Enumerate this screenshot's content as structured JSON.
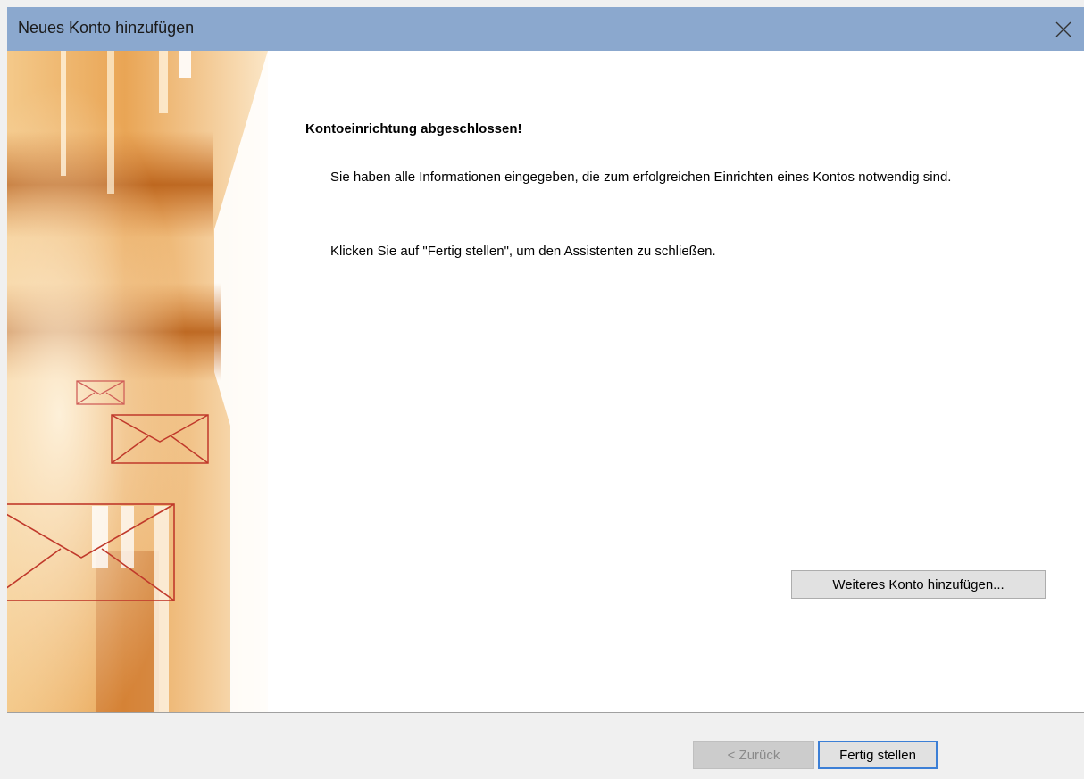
{
  "window": {
    "title": "Neues Konto hinzufügen",
    "close_icon": "close-icon"
  },
  "content": {
    "heading": "Kontoeinrichtung abgeschlossen!",
    "paragraph1": "Sie haben alle Informationen eingegeben, die zum erfolgreichen Einrichten eines Kontos notwendig sind.",
    "paragraph2": "Klicken Sie auf \"Fertig stellen\", um den Assistenten zu schließen.",
    "add_account_button": "Weiteres Konto hinzufügen..."
  },
  "footer": {
    "back_button": "< Zurück",
    "back_enabled": false,
    "finish_button": "Fertig stellen"
  },
  "colors": {
    "titlebar": "#8ba8ce",
    "banner_orange": "#e8a04a",
    "envelope_stroke": "#c0392b",
    "focus_border": "#3c7fd6"
  },
  "icons": {
    "banner": "outlook-envelope-banner"
  }
}
